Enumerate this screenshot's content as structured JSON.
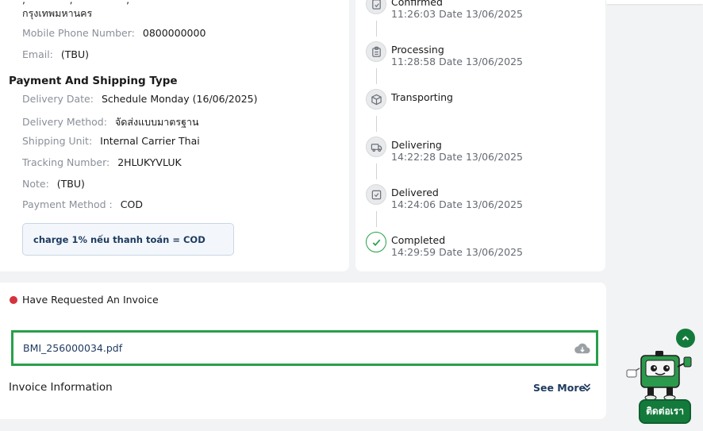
{
  "customer": {
    "address_top": "กรุงเทพมหานคร",
    "mobile_label": "Mobile Phone Number:",
    "mobile_value": "0800000000",
    "email_label": "Email:",
    "email_value": "(TBU)"
  },
  "shipping": {
    "title": "Payment And Shipping Type",
    "fields": [
      {
        "label": "Delivery Date:",
        "value": "Schedule Monday (16/06/2025)"
      },
      {
        "label": "Delivery Method:",
        "value": "จัดส่งแบบมาตรฐาน"
      },
      {
        "label": "Shipping Unit:",
        "value": "Internal Carrier Thai"
      },
      {
        "label": "Tracking Number:",
        "value": "2HLUKYVLUK"
      },
      {
        "label": "Note:",
        "value": "(TBU)"
      },
      {
        "label": "Payment Method :",
        "value": "COD"
      }
    ],
    "note_box": "charge 1% nếu thanh toán = COD"
  },
  "timeline": [
    {
      "title": "Confirmed",
      "time": "11:26:03 Date 13/06/2025",
      "icon": "confirmed-icon"
    },
    {
      "title": "Processing",
      "time": "11:28:58 Date 13/06/2025",
      "icon": "clipboard-icon"
    },
    {
      "title": "Transporting",
      "time": "",
      "icon": "box-icon"
    },
    {
      "title": "Delivering",
      "time": "14:22:28 Date 13/06/2025",
      "icon": "truck-icon"
    },
    {
      "title": "Delivered",
      "time": "14:24:06 Date 13/06/2025",
      "icon": "checkbox-icon"
    },
    {
      "title": "Completed",
      "time": "14:29:59 Date 13/06/2025",
      "icon": "check-circle-icon"
    }
  ],
  "invoice": {
    "requested_label": "Have Requested An Invoice",
    "file_name": "BMI_256000034.pdf",
    "info_title": "Invoice Information",
    "see_more": "See More"
  },
  "floating": {
    "contact_label": "ติดต่อเรา"
  },
  "colors": {
    "accent_green": "#27a04a",
    "dark_green": "#137a3c",
    "status_red": "#d3343b",
    "navy": "#1e3a5f"
  }
}
